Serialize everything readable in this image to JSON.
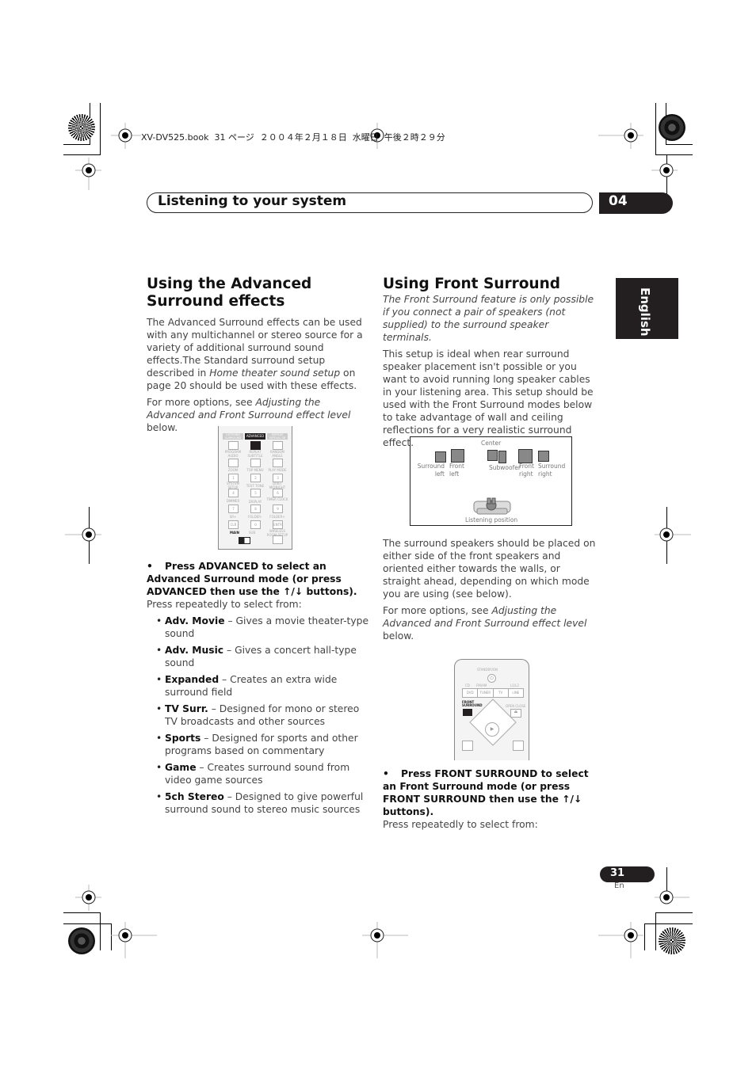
{
  "print_header": "XV-DV525.book  31 ページ  ２００４年２月１８日  水曜日  午後２時２９分",
  "header": {
    "title": "Listening to your system",
    "chapter": "04"
  },
  "language_tab": "English",
  "left": {
    "heading": "Using the Advanced Surround effects",
    "para1": "The Advanced Surround effects can be used with any multichannel or stereo source for a variety of additional surround sound effects.The Standard surround setup described in ",
    "para1_italic": "Home theater sound setup",
    "para1_end": " on page 20 should be used with these effects.",
    "para2_start": "For more options, see ",
    "para2_italic": "Adjusting the Advanced and Front Surround effect level",
    "para2_end": " below.",
    "remote": {
      "top_buttons": [
        "LISTENING SURROUND",
        "ADVANCED",
        "DISPLAY VIRTUAL SB"
      ],
      "labels": [
        "PROGRAM AUDIO",
        "REPEAT SUBTITLE",
        "RANDOM ANGLE",
        "ZOOM",
        "TOP MENU",
        "PLAY MODE",
        "SYSTEM SETUP",
        "TEST TONE",
        "QUIET MIDNIGHT",
        "DIMMER",
        "DISPLAY",
        "TIMER CLOCK",
        "SR+",
        "FOLDER–",
        "FOLDER+",
        "WIRELESS ROOM SETUP"
      ],
      "keys": [
        "1",
        "2",
        "3",
        "4",
        "5",
        "6",
        "7",
        "8",
        "9",
        "CLR",
        "0",
        "ENTR"
      ],
      "switch_main": "MAIN",
      "switch_sub": "SUB"
    },
    "instruction": "Press ADVANCED to select an Advanced Surround mode (or press ADVANCED then use the ↑/↓ buttons).",
    "press_repeatedly": "Press repeatedly to select from:",
    "modes": [
      {
        "name": "Adv. Movie",
        "desc": " – Gives a movie theater-type sound"
      },
      {
        "name": "Adv. Music",
        "desc": " – Gives a concert hall-type sound"
      },
      {
        "name": "Expanded",
        "desc": " – Creates an extra wide surround field"
      },
      {
        "name": "TV Surr.",
        "desc": " – Designed for mono or stereo TV broadcasts and other sources"
      },
      {
        "name": "Sports",
        "desc": " – Designed for sports and other programs based on commentary"
      },
      {
        "name": "Game",
        "desc": " – Creates surround sound from video game sources"
      },
      {
        "name": "5ch Stereo",
        "desc": " – Designed to give powerful surround sound to stereo music sources"
      }
    ]
  },
  "right": {
    "heading": "Using Front Surround",
    "intro_italic": "The Front Surround feature is only possible if you connect a pair of speakers (not supplied) to the surround speaker terminals.",
    "para1": "This setup is ideal when rear surround speaker placement isn't possible or you want to avoid running long speaker cables in your listening area. This setup should be used with the Front Surround modes below to take advantage of wall and ceiling reflections for a very realistic surround effect.",
    "diagram": {
      "center": "Center",
      "surround_left": "Surround left",
      "front_left": "Front left",
      "subwoofer": "Subwoofer",
      "front_right": "Front right",
      "surround_right": "Surround right",
      "listening": "Listening position"
    },
    "para2": "The surround speakers should be placed on either side of the front speakers and oriented either towards the walls, or straight ahead, depending on which mode you are using (see below).",
    "para3_start": "For more options, see ",
    "para3_italic": "Adjusting the Advanced and Front Surround effect level",
    "para3_end": " below.",
    "remote": {
      "standby": "STANDBY/ON",
      "top_labels": [
        "CD",
        "FM/AM",
        "L1/L2"
      ],
      "inputs": [
        "DVD",
        "TUNER",
        "TV",
        "LINE"
      ],
      "front_surround": "FRONT SURROUND",
      "open_close": "OPEN CLOSE"
    },
    "instruction": "Press FRONT SURROUND to select an Front Surround mode (or press FRONT SURROUND then use the ↑/↓ buttons).",
    "press_repeatedly": "Press repeatedly to select from:"
  },
  "footer": {
    "page": "31",
    "lang": "En"
  }
}
